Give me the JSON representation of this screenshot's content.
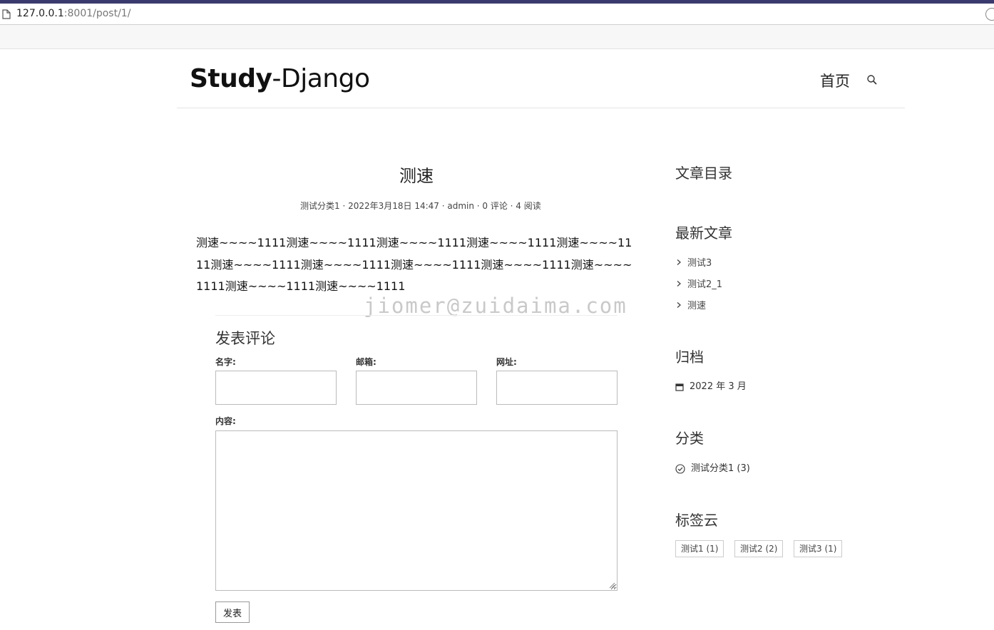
{
  "browser": {
    "url_host": "127.0.0.1",
    "url_rest": ":8001/post/1/"
  },
  "header": {
    "logo_part1": "Study",
    "logo_part2": "-Django",
    "nav_home": "首页",
    "search_icon": "search-icon"
  },
  "post": {
    "title": "测速",
    "meta": "测试分类1 · 2022年3月18日 14:47 · admin · 0 评论 · 4 阅读",
    "body": "测速~~~~1111测速~~~~1111测速~~~~1111测速~~~~1111测速~~~~1111测速~~~~1111测速~~~~1111测速~~~~1111测速~~~~1111测速~~~~1111测速~~~~1111测速~~~~1111",
    "watermark": "jiomer@zuidaima.com"
  },
  "comment_form": {
    "title": "发表评论",
    "name_label": "名字:",
    "email_label": "邮箱:",
    "url_label": "网址:",
    "content_label": "内容:",
    "name_value": "",
    "email_value": "",
    "url_value": "",
    "content_value": "",
    "submit_label": "发表"
  },
  "sidebar": {
    "toc_title": "文章目录",
    "recent_title": "最新文章",
    "recent_items": [
      "测试3",
      "测试2_1",
      "测速"
    ],
    "archive_title": "归档",
    "archive_items": [
      "2022 年 3 月"
    ],
    "category_title": "分类",
    "category_items": [
      "测试分类1 (3)"
    ],
    "tags_title": "标签云",
    "tags": [
      "测试1 (1)",
      "测试2 (2)",
      "测试3 (1)"
    ]
  }
}
